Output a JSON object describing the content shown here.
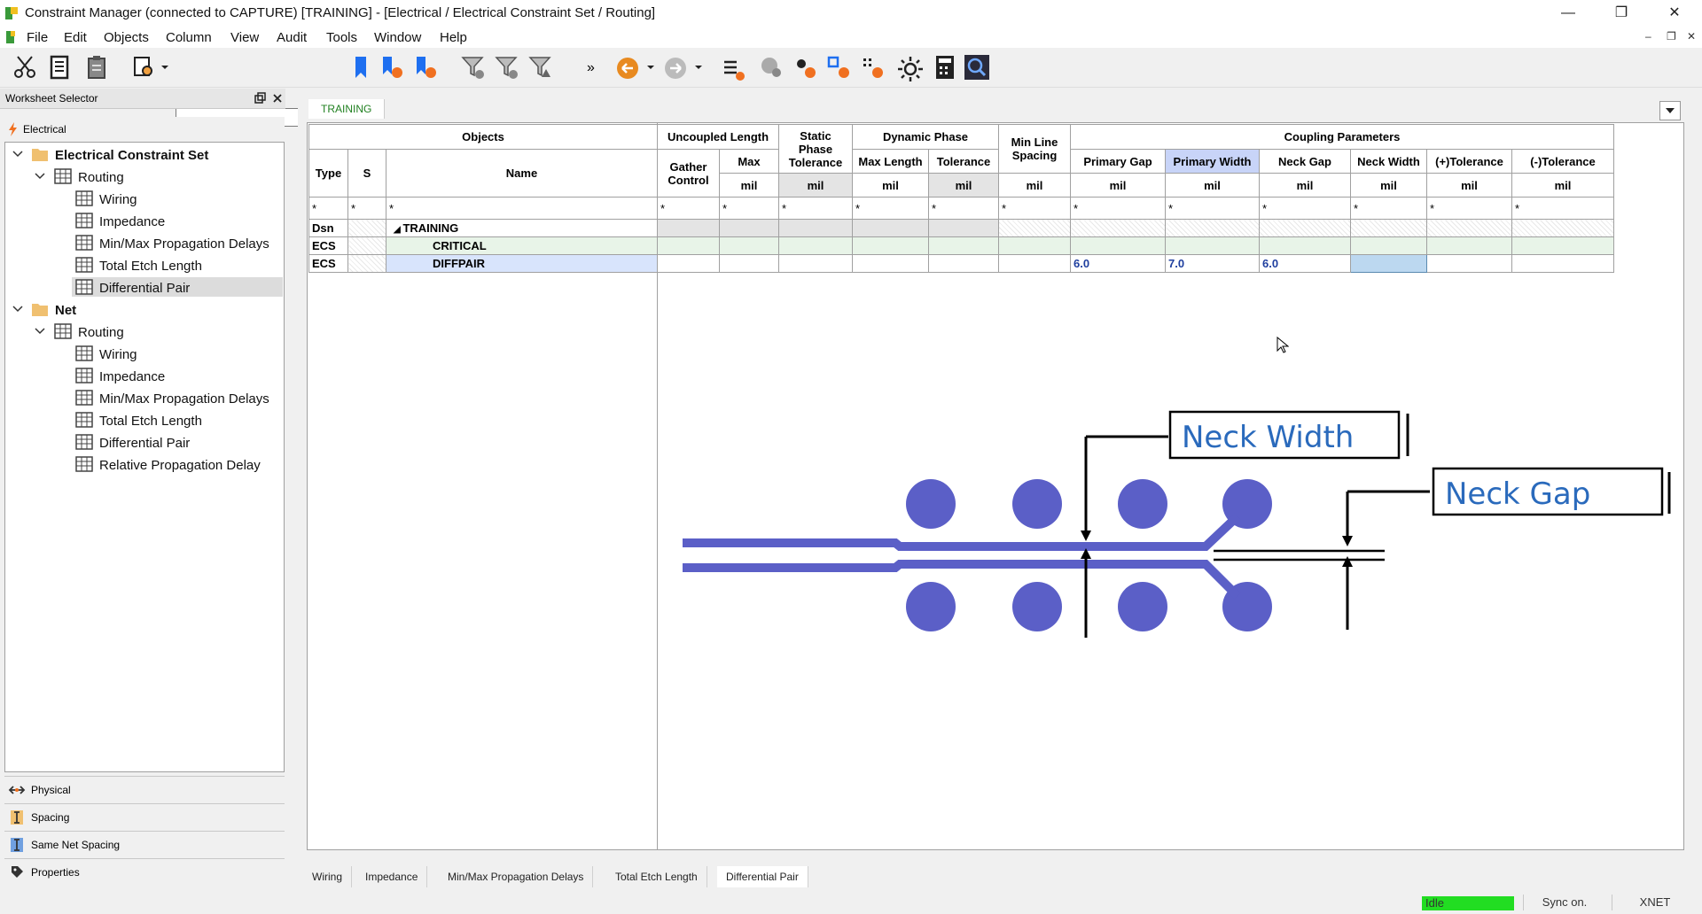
{
  "window": {
    "title": "Constraint Manager (connected to CAPTURE) [TRAINING] - [Electrical / Electrical Constraint Set / Routing]",
    "minimize": "—",
    "maximize": "❐",
    "close": "✕"
  },
  "menu": [
    "File",
    "Edit",
    "Objects",
    "Column",
    "View",
    "Audit",
    "Tools",
    "Window",
    "Help"
  ],
  "mdi": {
    "min": "–",
    "restore": "❐",
    "close": "✕"
  },
  "toolbar": {
    "overflow": "»"
  },
  "worksheet_selector": {
    "title": "Worksheet Selector",
    "category": "Electrical"
  },
  "tree": {
    "ecs": "Electrical Constraint Set",
    "ecs_routing": "Routing",
    "ecs_items": [
      "Wiring",
      "Impedance",
      "Min/Max Propagation Delays",
      "Total Etch Length",
      "Differential Pair"
    ],
    "net": "Net",
    "net_routing": "Routing",
    "net_items": [
      "Wiring",
      "Impedance",
      "Min/Max Propagation Delays",
      "Total Etch Length",
      "Differential Pair",
      "Relative Propagation Delay"
    ]
  },
  "bottom_sections": [
    "Physical",
    "Spacing",
    "Same Net Spacing",
    "Properties"
  ],
  "tab_top": "TRAINING",
  "table": {
    "objects": "Objects",
    "type": "Type",
    "s": "S",
    "name": "Name",
    "uncoupled_length": "Uncoupled Length",
    "gather_control": "Gather Control",
    "max": "Max",
    "static_phase": "Static Phase Tolerance",
    "dynamic_phase": "Dynamic Phase",
    "max_length": "Max Length",
    "tolerance": "Tolerance",
    "min_line_spacing": "Min Line Spacing",
    "coupling_parameters": "Coupling Parameters",
    "primary_gap": "Primary Gap",
    "primary_width": "Primary Width",
    "neck_gap": "Neck Gap",
    "neck_width": "Neck Width",
    "plus_tol": "(+)Tolerance",
    "minus_tol": "(-)Tolerance",
    "unit": "mil",
    "filter": "*",
    "rows": [
      {
        "type": "Dsn",
        "name": "TRAINING"
      },
      {
        "type": "ECS",
        "name": "CRITICAL"
      },
      {
        "type": "ECS",
        "name": "DIFFPAIR",
        "primary_gap": "6.0",
        "primary_width": "7.0",
        "neck_gap": "6.0"
      }
    ]
  },
  "diagram": {
    "neck_width_label": "Neck Width",
    "neck_gap_label": "Neck Gap",
    "trace_color": "#5b5fc7"
  },
  "bottom_tabs": [
    "Wiring",
    "Impedance",
    "Min/Max Propagation Delays",
    "Total Etch Length",
    "Differential Pair"
  ],
  "status": {
    "state": "Idle",
    "sync": "Sync on.",
    "mode": "XNET"
  },
  "colors": {
    "accent": "#d8e4fc",
    "status_idle": "#22dd22"
  }
}
